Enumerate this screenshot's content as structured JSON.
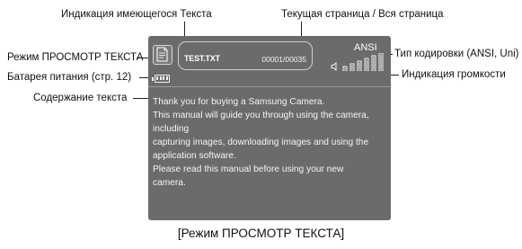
{
  "callouts": {
    "text_indicator": "Индикация имеющегося Текста",
    "page_indicator": "Текущая страница / Вся страница",
    "view_mode": "Режим ПРОСМОТР ТЕКСТА",
    "battery": "Батарея питания (стр. 12)",
    "text_content": "Содержание текста",
    "encoding_type": "Тип кодировки (ANSI, Uni)",
    "volume": "Индикация громкости"
  },
  "screen": {
    "file_name": "TEST.TXT",
    "page_counter": "00001/00035",
    "encoding": "ANSI",
    "mode_icon": "text-document-icon",
    "speaker_icon": "speaker-icon",
    "volume_level": 1.0,
    "volume_bars": 6,
    "battery_icon": "battery-icon",
    "text_lines": [
      "Thank you for buying a Samsung Camera.",
      "This manual will guide you through using the camera,",
      "including",
      "capturing images, downloading images and using the",
      "application software.",
      "Please read this manual before using your new",
      "camera."
    ]
  },
  "caption": "[Режим ПРОСМОТР ТЕКСТА]"
}
